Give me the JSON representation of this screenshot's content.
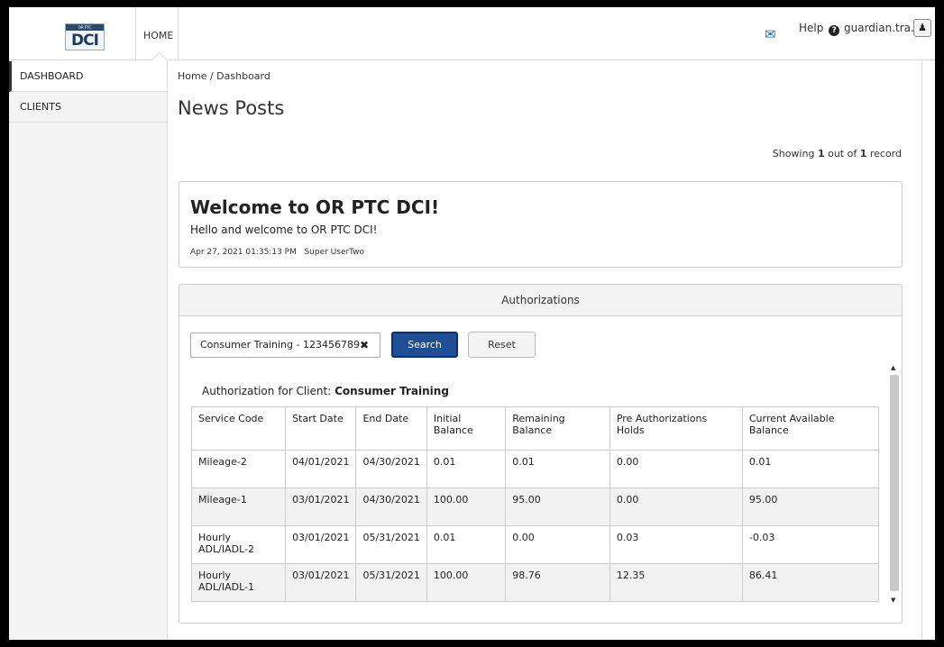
{
  "header": {
    "logo_top": "OR PTC",
    "logo_text": "DCI",
    "home_label": "HOME",
    "help_label": "Help",
    "help_icon": "?",
    "user_label": "guardian.tra...",
    "user_icon": "♟"
  },
  "sidebar": {
    "items": [
      {
        "label": "DASHBOARD"
      },
      {
        "label": "CLIENTS"
      }
    ]
  },
  "main": {
    "breadcrumb": "Home / Dashboard",
    "title": "News Posts",
    "showing_prefix": "Showing ",
    "showing_num1": "1",
    "showing_mid": " out of ",
    "showing_num2": "1",
    "showing_suffix": " record"
  },
  "news": {
    "title": "Welcome to OR PTC DCI!",
    "body": "Hello and welcome to OR PTC DCI!",
    "date": "Apr 27, 2021 01:35:13 PM",
    "author": "Super UserTwo"
  },
  "authorizations": {
    "panel_title": "Authorizations",
    "search_value": "Consumer Training - 123456789",
    "clear_icon": "✖",
    "search_label": "Search",
    "reset_label": "Reset",
    "client_prefix": "Authorization for Client: ",
    "client_name": "Consumer Training",
    "columns": [
      "Service Code",
      "Start Date",
      "End Date",
      "Initial Balance",
      "Remaining Balance",
      "Pre Authorizations Holds",
      "Current Available Balance"
    ],
    "rows": [
      [
        "Mileage-2",
        "04/01/2021",
        "04/30/2021",
        "0.01",
        "0.01",
        "0.00",
        "0.01"
      ],
      [
        "Mileage-1",
        "03/01/2021",
        "04/30/2021",
        "100.00",
        "95.00",
        "0.00",
        "95.00"
      ],
      [
        "Hourly ADL/IADL-2",
        "03/01/2021",
        "05/31/2021",
        "0.01",
        "0.00",
        "0.03",
        "-0.03"
      ],
      [
        "Hourly ADL/IADL-1",
        "03/01/2021",
        "05/31/2021",
        "100.00",
        "98.76",
        "12.35",
        "86.41"
      ]
    ]
  },
  "icons": {
    "mail": "mail-icon",
    "help": "help-icon",
    "user": "user-icon"
  }
}
